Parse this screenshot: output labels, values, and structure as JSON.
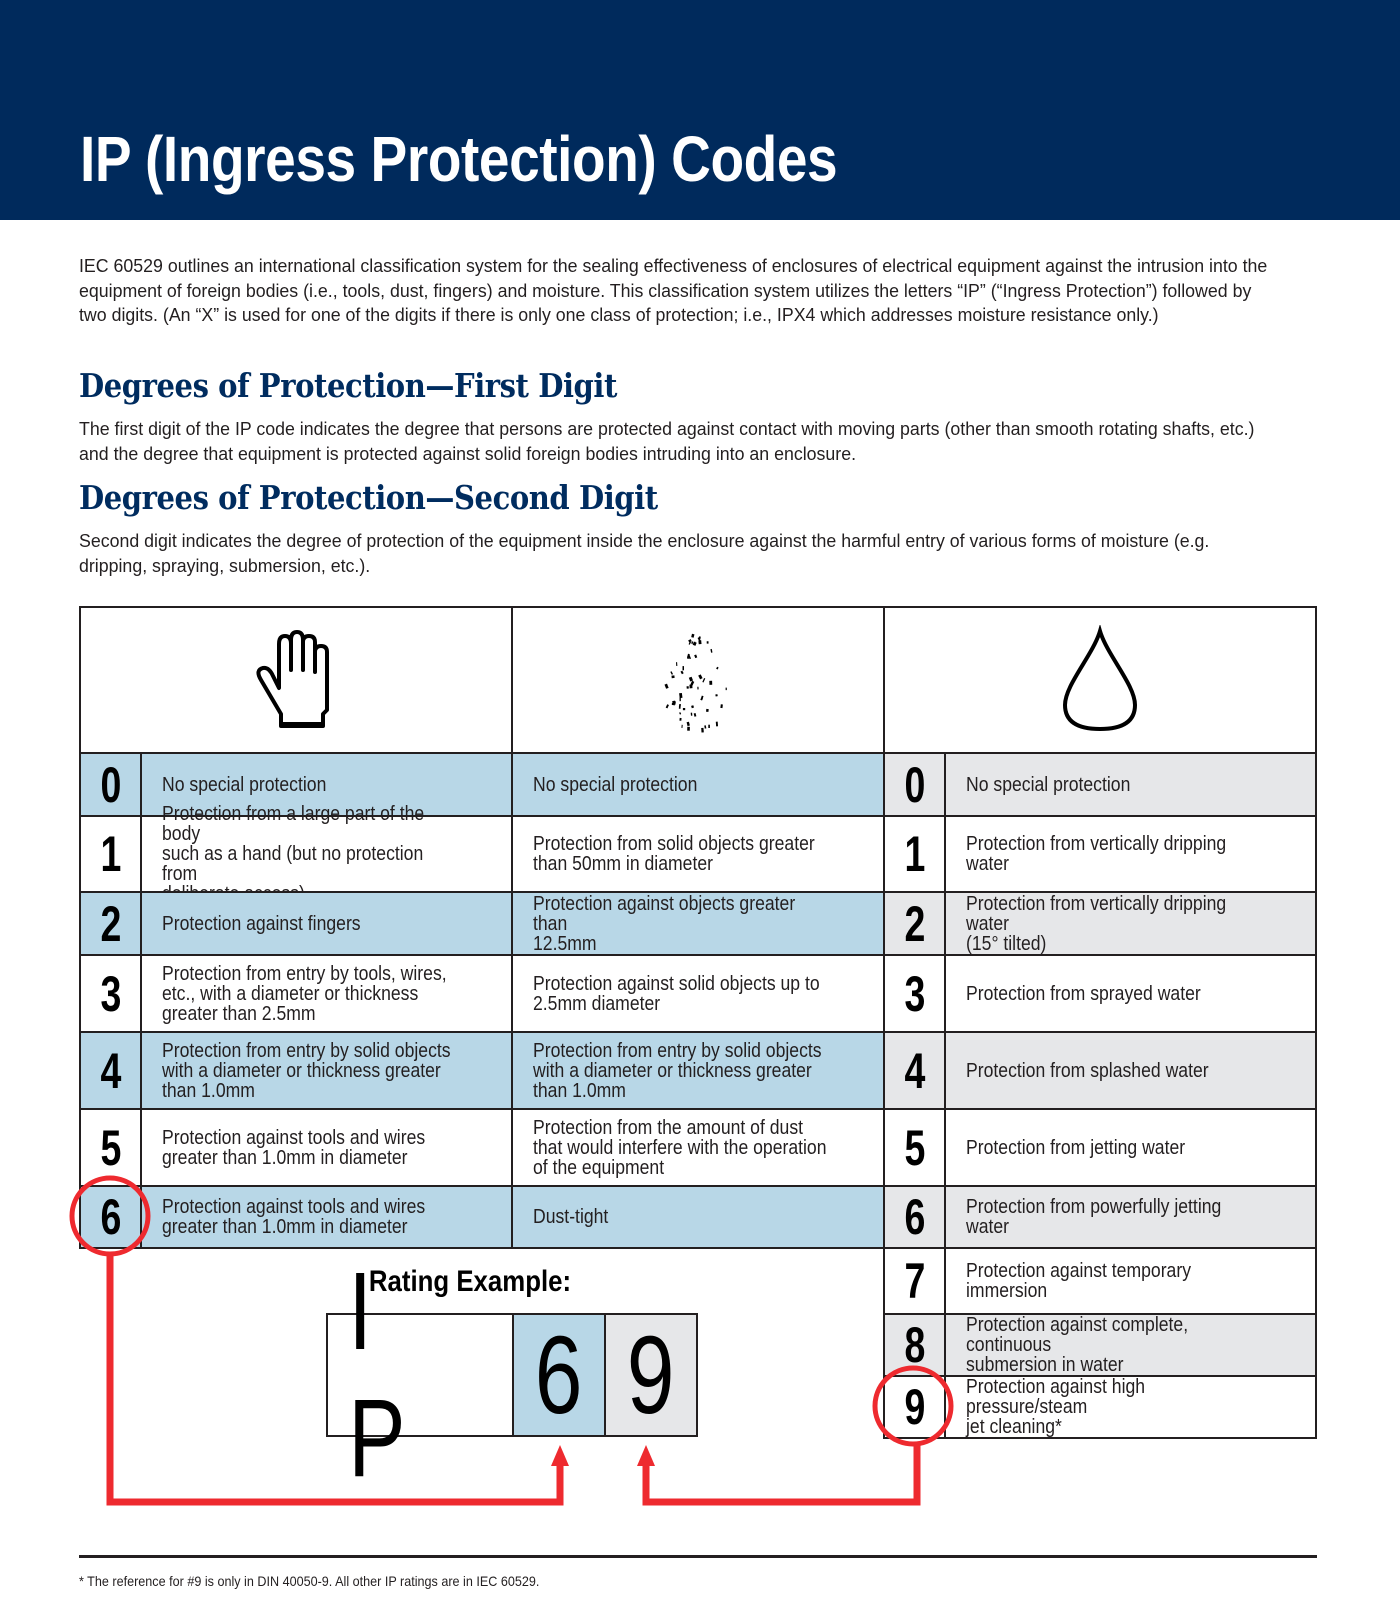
{
  "header": {
    "title": "IP (Ingress Protection) Codes"
  },
  "intro": "IEC 60529 outlines an international classification system for the sealing effectiveness of enclosures of electrical equipment against the intrusion into the equipment of foreign bodies (i.e., tools, dust, fingers) and moisture. This classification system utilizes the letters “IP” (“Ingress Protection”) followed by two digits. (An “X” is used for one of the digits if there is only one class of protection; i.e., IPX4 which addresses moisture resistance only.)",
  "sections": [
    {
      "heading": "Degrees of Protection—First Digit",
      "body": "The first digit of the IP code indicates the degree that persons are protected against contact with moving parts (other than smooth rotating shafts, etc.) and the degree that equipment is protected against solid foreign bodies intruding into an enclosure."
    },
    {
      "heading": "Degrees of Protection—Second Digit",
      "body": "Second digit indicates the degree of protection of the equipment inside the enclosure against the harmful entry of various forms of moisture (e.g. dripping, spraying, submersion, etc.)."
    }
  ],
  "table": {
    "icons": [
      "hand-icon",
      "dust-particles-icon",
      "water-drop-icon"
    ],
    "first_digit": [
      {
        "digit": "0",
        "persons": "No special protection",
        "solids": "No special protection"
      },
      {
        "digit": "1",
        "persons": "Protection from a large part of the body\nsuch as a hand (but no protection from\ndeliberate access)",
        "solids": "Protection from solid objects greater\nthan 50mm in diameter"
      },
      {
        "digit": "2",
        "persons": "Protection against fingers",
        "solids": "Protection against objects greater than\n12.5mm"
      },
      {
        "digit": "3",
        "persons": "Protection from entry by tools, wires,\netc., with a diameter or thickness\ngreater than 2.5mm",
        "solids": "Protection against solid objects up to\n2.5mm diameter"
      },
      {
        "digit": "4",
        "persons": "Protection from entry by solid objects\nwith a diameter or thickness greater\nthan 1.0mm",
        "solids": "Protection from entry by solid objects\nwith a diameter or thickness greater\nthan 1.0mm"
      },
      {
        "digit": "5",
        "persons": "Protection against tools and wires\ngreater than 1.0mm in diameter",
        "solids": "Protection from the amount of dust\nthat would interfere with the operation\nof the equipment"
      },
      {
        "digit": "6",
        "persons": "Protection against tools and wires\ngreater than 1.0mm in diameter",
        "solids": "Dust-tight"
      }
    ],
    "second_digit": [
      {
        "digit": "0",
        "moisture": "No special protection"
      },
      {
        "digit": "1",
        "moisture": "Protection from vertically dripping water"
      },
      {
        "digit": "2",
        "moisture": "Protection from vertically dripping water\n(15° tilted)"
      },
      {
        "digit": "3",
        "moisture": "Protection from sprayed water"
      },
      {
        "digit": "4",
        "moisture": "Protection from splashed water"
      },
      {
        "digit": "5",
        "moisture": "Protection from jetting water"
      },
      {
        "digit": "6",
        "moisture": "Protection from powerfully jetting water"
      },
      {
        "digit": "7",
        "moisture": "Protection against temporary immersion"
      },
      {
        "digit": "8",
        "moisture": "Protection against complete, continuous\nsubmersion in water"
      },
      {
        "digit": "9",
        "moisture": "Protection against high pressure/steam\njet cleaning*"
      }
    ]
  },
  "rating_example": {
    "title": "Rating Example:",
    "prefix": "I P",
    "first_digit": "6",
    "second_digit": "9",
    "highlighted_first": "6",
    "highlighted_second": "9"
  },
  "footnote": "* The reference for #9 is only in DIN 40050-9. All other IP ratings are in IEC 60529.",
  "colors": {
    "banner": "#002a5c",
    "heading": "#002c5f",
    "first_digit_highlight": "#b8d7e7",
    "second_digit_highlight": "#e6e7e9",
    "callout": "#ee2a2f"
  }
}
